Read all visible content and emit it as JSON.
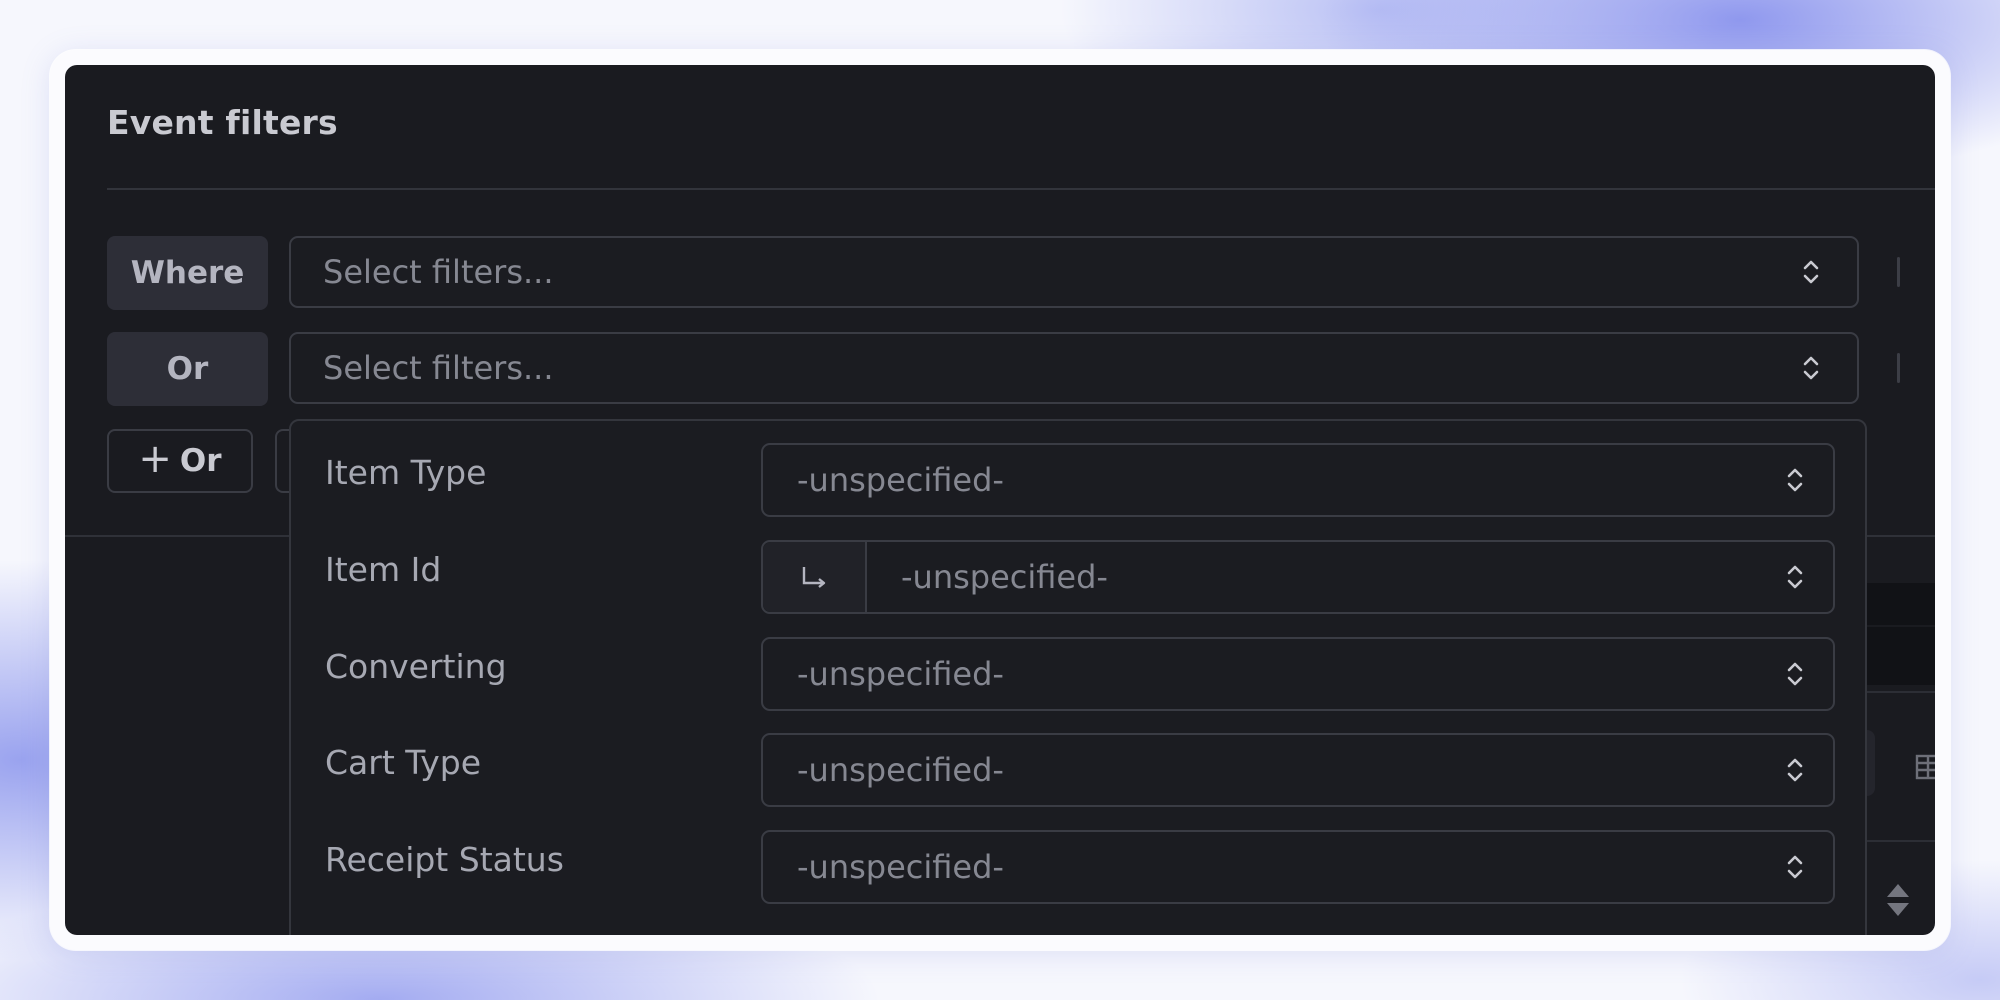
{
  "title": "Event filters",
  "clauses": [
    {
      "keyword": "Where",
      "placeholder": "Select filters..."
    },
    {
      "keyword": "Or",
      "placeholder": "Select filters..."
    }
  ],
  "add_or_label": "Or",
  "dropdown": {
    "rows": [
      {
        "label": "Item Type",
        "value": "-unspecified-"
      },
      {
        "label": "Item Id",
        "value": "-unspecified-"
      },
      {
        "label": "Converting",
        "value": "-unspecified-"
      },
      {
        "label": "Cart Type",
        "value": "-unspecified-"
      },
      {
        "label": "Receipt Status",
        "value": "-unspecified-"
      }
    ]
  },
  "icons": {
    "select_chevron": "chevron-up-down-icon",
    "plus": "plus-icon",
    "nested": "nested-arrow-icon",
    "grid": "grid-icon",
    "sort": "sort-icon"
  },
  "colors": {
    "panel_bg": "#1a1b20",
    "chip_bg": "#2d2e37",
    "border": "#3a3c44",
    "muted_text": "#868892"
  }
}
